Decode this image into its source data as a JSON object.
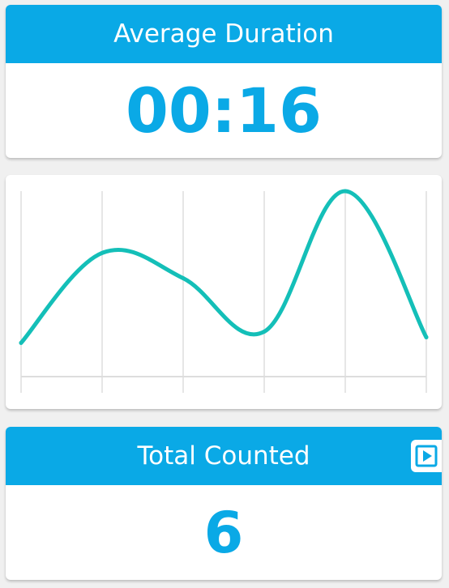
{
  "colors": {
    "accent": "#0aa9e6",
    "line": "#14bfb8",
    "grid": "#dddddd"
  },
  "duration_card": {
    "title": "Average Duration",
    "value": "00:16"
  },
  "chart_data": {
    "type": "line",
    "x": [
      0,
      1,
      2,
      3,
      4,
      5
    ],
    "series": [
      {
        "values": [
          16,
          32,
          27.5,
          18,
          43,
          17
        ]
      }
    ],
    "ylim": [
      10,
      43
    ],
    "grid": true,
    "title": "",
    "xlabel": "",
    "ylabel": ""
  },
  "total_card": {
    "title": "Total Counted",
    "value": "6",
    "play_icon": "play-icon"
  }
}
